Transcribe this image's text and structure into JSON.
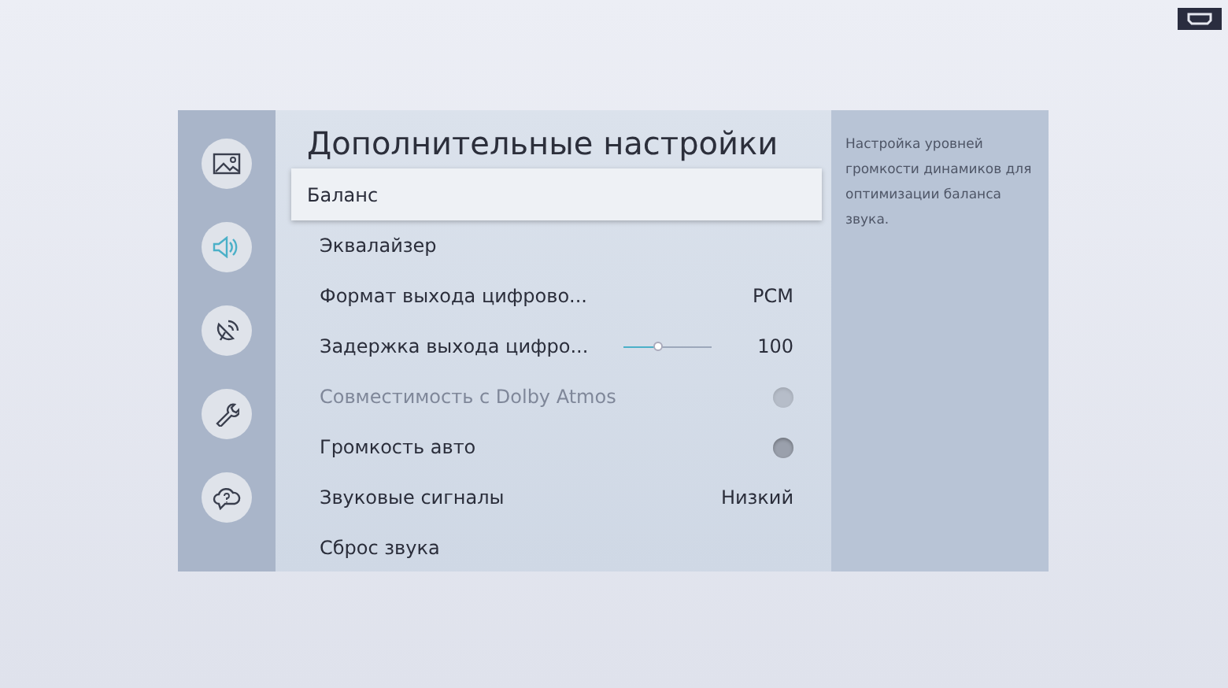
{
  "sidebar": {
    "items": [
      {
        "selected": false
      },
      {
        "selected": true
      },
      {
        "selected": false
      },
      {
        "selected": false
      },
      {
        "selected": false
      }
    ]
  },
  "title": "Дополнительные настройки",
  "rows": [
    {
      "kind": "plain",
      "label": "Баланс",
      "selected": true,
      "disabled": false
    },
    {
      "kind": "plain",
      "label": "Эквалайзер",
      "selected": false,
      "disabled": false
    },
    {
      "kind": "value",
      "label": "Формат выхода цифрово...",
      "value": "PCM",
      "selected": false,
      "disabled": false
    },
    {
      "kind": "slider",
      "label": "Задержка выхода цифро...",
      "value": "100",
      "level": 0.4,
      "selected": false,
      "disabled": false
    },
    {
      "kind": "toggle",
      "label": "Совместимость с Dolby Atmos",
      "on": false,
      "selected": false,
      "disabled": true
    },
    {
      "kind": "toggle",
      "label": "Громкость авто",
      "on": false,
      "selected": false,
      "disabled": false
    },
    {
      "kind": "value",
      "label": "Звуковые сигналы",
      "value": "Низкий",
      "selected": false,
      "disabled": false
    },
    {
      "kind": "plain",
      "label": "Сброс звука",
      "selected": false,
      "disabled": false
    }
  ],
  "description": "Настройка уровней громкости динамиков для оптимизации баланса звука."
}
